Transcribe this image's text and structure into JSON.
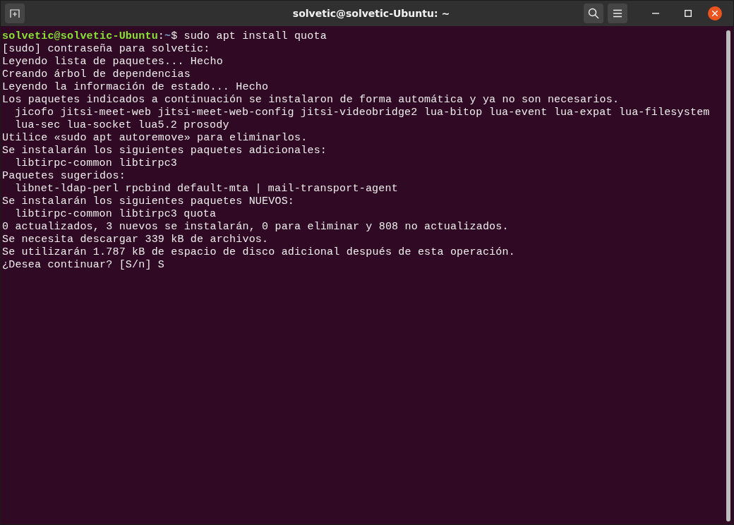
{
  "window": {
    "title": "solvetic@solvetic-Ubuntu: ~"
  },
  "terminal": {
    "lines": [
      {
        "kind": "prompt",
        "user_host": "solvetic@solvetic-Ubuntu",
        "separator": ":",
        "path": "~",
        "symbol": "$",
        "command": "sudo apt install quota"
      },
      {
        "kind": "output",
        "text": "[sudo] contraseña para solvetic:"
      },
      {
        "kind": "output",
        "text": "Leyendo lista de paquetes... Hecho"
      },
      {
        "kind": "output",
        "text": "Creando árbol de dependencias"
      },
      {
        "kind": "output",
        "text": "Leyendo la información de estado... Hecho"
      },
      {
        "kind": "output",
        "text": "Los paquetes indicados a continuación se instalaron de forma automática y ya no son necesarios."
      },
      {
        "kind": "indented",
        "text": "jicofo jitsi-meet-web jitsi-meet-web-config jitsi-videobridge2 lua-bitop lua-event lua-expat lua-filesystem"
      },
      {
        "kind": "indented",
        "text": "lua-sec lua-socket lua5.2 prosody"
      },
      {
        "kind": "output",
        "text": "Utilice «sudo apt autoremove» para eliminarlos."
      },
      {
        "kind": "output",
        "text": "Se instalarán los siguientes paquetes adicionales:"
      },
      {
        "kind": "indented",
        "text": "libtirpc-common libtirpc3"
      },
      {
        "kind": "output",
        "text": "Paquetes sugeridos:"
      },
      {
        "kind": "indented",
        "text": "libnet-ldap-perl rpcbind default-mta | mail-transport-agent"
      },
      {
        "kind": "output",
        "text": "Se instalarán los siguientes paquetes NUEVOS:"
      },
      {
        "kind": "indented",
        "text": "libtirpc-common libtirpc3 quota"
      },
      {
        "kind": "output",
        "text": "0 actualizados, 3 nuevos se instalarán, 0 para eliminar y 808 no actualizados."
      },
      {
        "kind": "output",
        "text": "Se necesita descargar 339 kB de archivos."
      },
      {
        "kind": "output",
        "text": "Se utilizarán 1.787 kB de espacio de disco adicional después de esta operación."
      },
      {
        "kind": "output",
        "text": "¿Desea continuar? [S/n] S"
      }
    ]
  }
}
